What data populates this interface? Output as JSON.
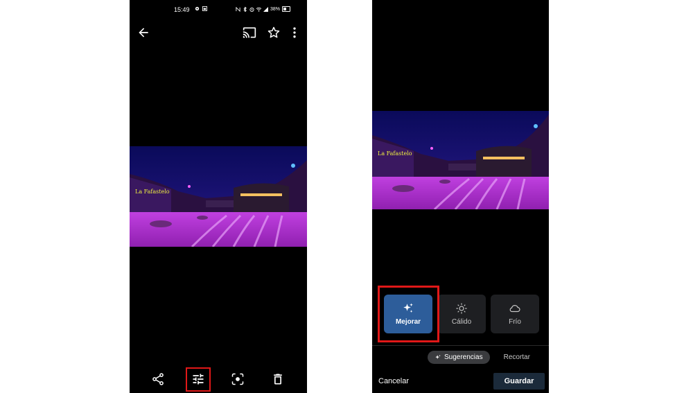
{
  "left_screen": {
    "status_bar": {
      "time": "15:49",
      "battery": "38%"
    },
    "toolbar": {
      "back_icon": "arrow-back-icon",
      "cast_icon": "cast-icon",
      "favorite_icon": "star-icon",
      "more_icon": "more-vert-icon"
    },
    "actions": {
      "share_icon": "share-icon",
      "edit_icon": "tune-icon",
      "lens_icon": "lens-icon",
      "delete_icon": "trash-icon"
    },
    "highlight_color": "#e01818"
  },
  "right_screen": {
    "suggestions": [
      {
        "label": "Mejorar",
        "icon": "sparkle-icon",
        "active": true
      },
      {
        "label": "Cálido",
        "icon": "sun-icon",
        "active": false
      },
      {
        "label": "Frío",
        "icon": "cloud-icon",
        "active": false
      }
    ],
    "tabs": {
      "active": "Sugerencias",
      "other": "Recortar"
    },
    "cancel_label": "Cancelar",
    "save_label": "Guardar",
    "accent_color": "#2d5d9a",
    "highlight_color": "#e01818"
  }
}
